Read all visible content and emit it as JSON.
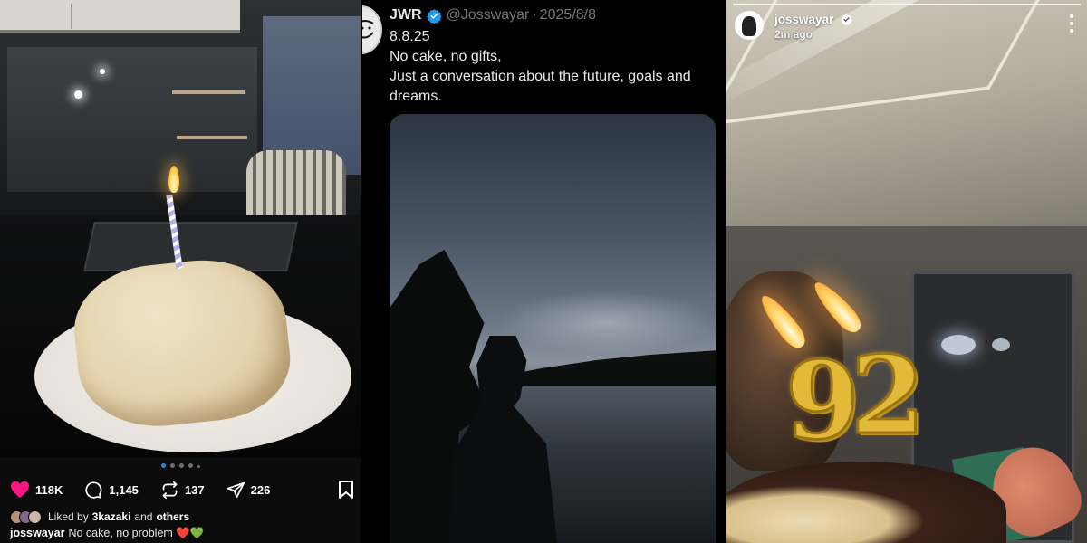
{
  "post": {
    "likes": "118K",
    "comments": "1,145",
    "reposts": "137",
    "shares": "226",
    "liked_prefix": "Liked by",
    "liked_user": "3kazaki",
    "liked_and": "and",
    "liked_others": "others",
    "caption_user": "josswayar",
    "caption_text": "No cake, no problem ❤️💚",
    "carousel": {
      "count": 5,
      "active_index": 0
    }
  },
  "tweet": {
    "name": "JWR",
    "handle": "@Josswayar",
    "separator": "·",
    "date": "2025/8/8",
    "lines": [
      "8.8.25",
      "No cake, no gifts,",
      "Just a conversation about the future, goals and dreams."
    ]
  },
  "story": {
    "username": "josswayar",
    "time": "2m ago",
    "candle_digits": [
      "9",
      "2"
    ]
  },
  "colors": {
    "heart": "#f91880",
    "verified_x": "#1d9bf0",
    "carousel_active": "#2f7fe0"
  },
  "icons": [
    "heart-icon",
    "comment-icon",
    "repost-icon",
    "share-icon",
    "bookmark-icon",
    "verified-badge-icon",
    "more-options-icon"
  ]
}
